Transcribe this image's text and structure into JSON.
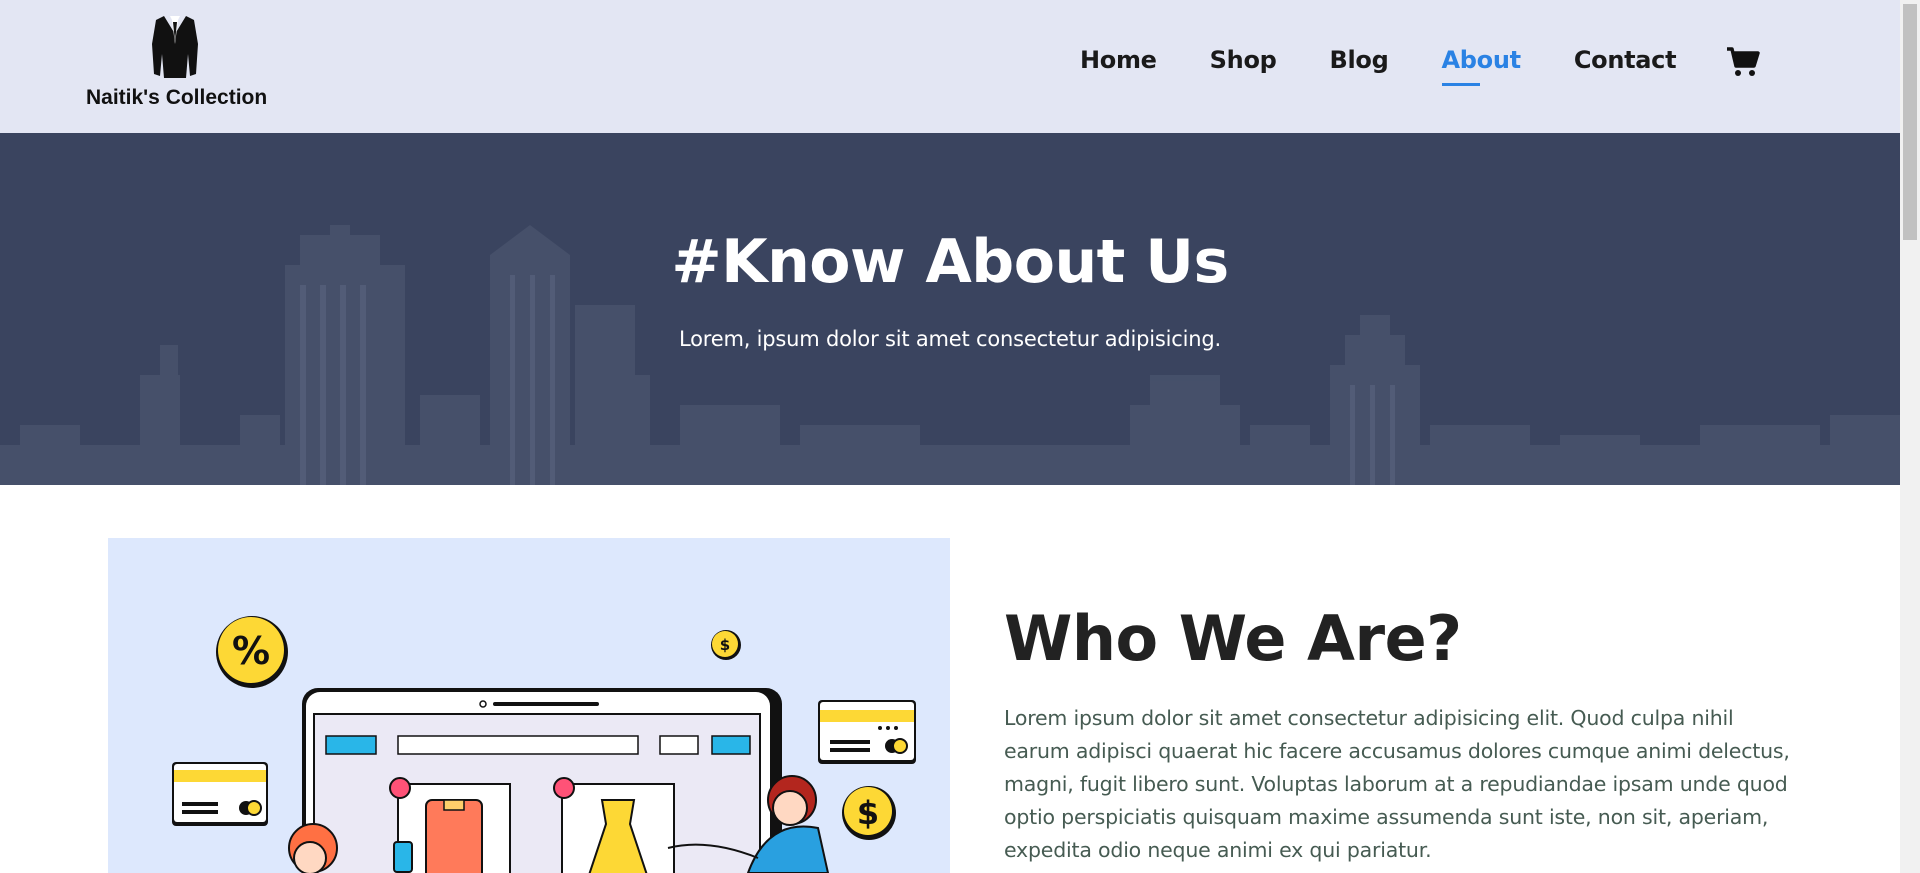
{
  "brand": {
    "name": "Naitik's Collection",
    "logo_icon": "suit-icon"
  },
  "nav": {
    "items": [
      {
        "label": "Home",
        "active": false
      },
      {
        "label": "Shop",
        "active": false
      },
      {
        "label": "Blog",
        "active": false
      },
      {
        "label": "About",
        "active": true
      },
      {
        "label": "Contact",
        "active": false
      }
    ],
    "cart_icon": "shopping-cart-icon"
  },
  "hero": {
    "title": "#Know About Us",
    "subtitle": "Lorem, ipsum dolor sit amet consectetur adipisicing."
  },
  "about": {
    "title": "Who We Are?",
    "text": "Lorem ipsum dolor sit amet consectetur adipisicing elit. Quod culpa nihil earum adipisci quaerat hic facere accusamus dolores cumque animi delectus, magni, fugit libero sunt. Voluptas laborum at a repudiandae ipsam unde quod optio perspiciatis quisquam maxime assumenda sunt iste, non sit, aperiam, expedita odio neque animi ex qui pariatur."
  },
  "colors": {
    "header_bg": "#e3e6f3",
    "active_link": "#2a82e4",
    "hero_bg": "#3a445f",
    "illustration_bg": "#dde8fd"
  },
  "illustration": {
    "percent_symbol": "%",
    "dollar_symbol": "$"
  }
}
